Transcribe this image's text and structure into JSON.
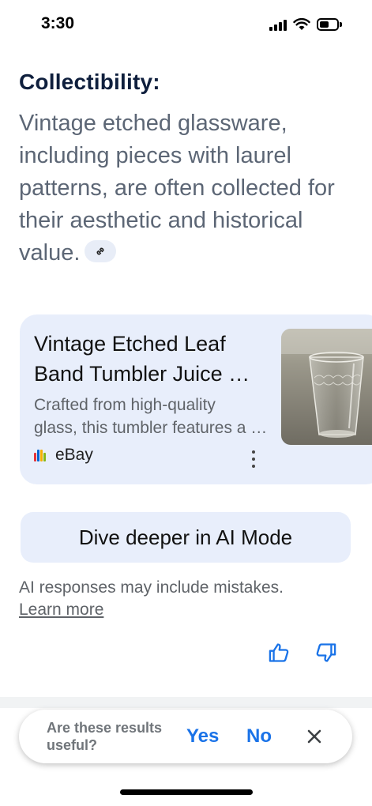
{
  "status_bar": {
    "time": "3:30",
    "battery_level": 0.55
  },
  "overview": {
    "heading": "Collectibility:",
    "body": "Vintage etched glassware, including pieces with laurel patterns, are often collected for their aesthetic and historical value.",
    "link_icon": "link-icon"
  },
  "result_card": {
    "title_line1": "Vintage Etched Leaf",
    "title_line2": "Band Tumbler Juice Glass",
    "desc_line1": "Crafted from high-quality",
    "desc_line2": "glass, this tumbler features a leaf band",
    "source": "eBay",
    "source_logo_colors": [
      "#e53238",
      "#0064d2",
      "#f5af02",
      "#86b817"
    ],
    "menu_icon": "more-vert-icon"
  },
  "dive_deeper": {
    "label": "Dive deeper in AI Mode"
  },
  "disclaimer": {
    "text": "AI responses may include mistakes.",
    "link": "Learn more"
  },
  "feedback": {
    "question": "Are these results useful?",
    "yes": "Yes",
    "no": "No",
    "close_icon": "close-icon"
  },
  "colors": {
    "accent": "#1a73e8",
    "card_bg": "#e8eefb",
    "heading": "#0f1f3d",
    "body_text": "#5c6675"
  }
}
